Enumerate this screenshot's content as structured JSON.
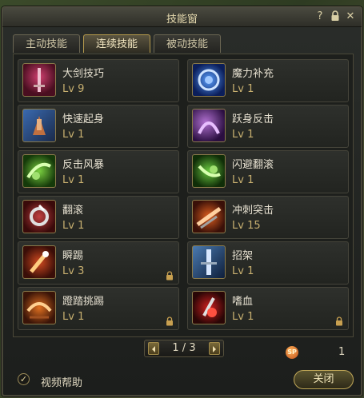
{
  "window": {
    "title": "技能窗",
    "help_icon": "question-icon",
    "lock_icon": "lock-icon",
    "close_icon": "close-icon"
  },
  "tabs": [
    {
      "label": "主动技能",
      "active": false
    },
    {
      "label": "连续技能",
      "active": true
    },
    {
      "label": "被动技能",
      "active": false
    }
  ],
  "skills": [
    {
      "name": "大剑技巧",
      "level": "Lv 9",
      "icon": "greatsword-skill-icon",
      "locked": false
    },
    {
      "name": "魔力补充",
      "level": "Lv 1",
      "icon": "mana-replenish-icon",
      "locked": false
    },
    {
      "name": "快速起身",
      "level": "Lv 1",
      "icon": "quick-rise-icon",
      "locked": false
    },
    {
      "name": "跃身反击",
      "level": "Lv 1",
      "icon": "leap-counter-icon",
      "locked": false
    },
    {
      "name": "反击风暴",
      "level": "Lv 1",
      "icon": "counter-storm-icon",
      "locked": false
    },
    {
      "name": "闪避翻滚",
      "level": "Lv 1",
      "icon": "dodge-roll-icon",
      "locked": false
    },
    {
      "name": "翻滚",
      "level": "Lv 1",
      "icon": "roll-icon",
      "locked": false
    },
    {
      "name": "冲刺突击",
      "level": "Lv 15",
      "icon": "dash-strike-icon",
      "locked": false
    },
    {
      "name": "瞬踢",
      "level": "Lv 3",
      "icon": "instant-kick-icon",
      "locked": true
    },
    {
      "name": "招架",
      "level": "Lv 1",
      "icon": "parry-icon",
      "locked": false
    },
    {
      "name": "蹬踏挑踢",
      "level": "Lv 1",
      "icon": "stomp-kick-icon",
      "locked": true
    },
    {
      "name": "嗜血",
      "level": "Lv 1",
      "icon": "bloodthirst-icon",
      "locked": true
    }
  ],
  "pager": {
    "text": "1 / 3",
    "prev_icon": "arrow-left-icon",
    "next_icon": "arrow-right-icon"
  },
  "sp": {
    "badge": "SP",
    "value": "1"
  },
  "footer": {
    "video_help_label": "视频帮助",
    "video_help_checked": true,
    "close_label": "关闭"
  },
  "colors": {
    "accent": "#b59a4c",
    "level_text": "#c8b070",
    "text": "#e6e0d0"
  }
}
